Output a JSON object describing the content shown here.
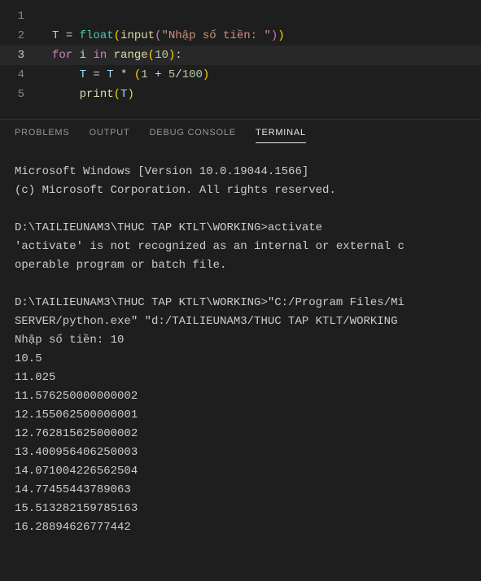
{
  "editor": {
    "lines": [
      {
        "num": "1",
        "tokens": []
      },
      {
        "num": "2",
        "tokens": [
          {
            "t": "T",
            "c": "tok-var"
          },
          {
            "t": " ",
            "c": "tok-op"
          },
          {
            "t": "=",
            "c": "tok-op"
          },
          {
            "t": " ",
            "c": "tok-op"
          },
          {
            "t": "float",
            "c": "tok-builtin"
          },
          {
            "t": "(",
            "c": "tok-paren-y"
          },
          {
            "t": "input",
            "c": "tok-func"
          },
          {
            "t": "(",
            "c": "tok-paren-p"
          },
          {
            "t": "\"Nhập số tiền: \"",
            "c": "tok-str"
          },
          {
            "t": ")",
            "c": "tok-paren-p"
          },
          {
            "t": ")",
            "c": "tok-paren-y"
          }
        ]
      },
      {
        "num": "3",
        "active": true,
        "tokens": [
          {
            "t": "for",
            "c": "tok-keyword"
          },
          {
            "t": " ",
            "c": "tok-op"
          },
          {
            "t": "i",
            "c": "tok-var"
          },
          {
            "t": " ",
            "c": "tok-op"
          },
          {
            "t": "in",
            "c": "tok-keyword"
          },
          {
            "t": " ",
            "c": "tok-op"
          },
          {
            "t": "range",
            "c": "tok-func"
          },
          {
            "t": "(",
            "c": "tok-paren-y"
          },
          {
            "t": "10",
            "c": "tok-num"
          },
          {
            "t": ")",
            "c": "tok-paren-y"
          },
          {
            "t": ":",
            "c": "tok-op"
          }
        ]
      },
      {
        "num": "4",
        "tokens": [
          {
            "t": "    ",
            "c": "tok-op"
          },
          {
            "t": "T",
            "c": "tok-var"
          },
          {
            "t": " ",
            "c": "tok-op"
          },
          {
            "t": "=",
            "c": "tok-op"
          },
          {
            "t": " ",
            "c": "tok-op"
          },
          {
            "t": "T",
            "c": "tok-var"
          },
          {
            "t": " ",
            "c": "tok-op"
          },
          {
            "t": "*",
            "c": "tok-op"
          },
          {
            "t": " ",
            "c": "tok-op"
          },
          {
            "t": "(",
            "c": "tok-paren-y"
          },
          {
            "t": "1",
            "c": "tok-num"
          },
          {
            "t": " ",
            "c": "tok-op"
          },
          {
            "t": "+",
            "c": "tok-op"
          },
          {
            "t": " ",
            "c": "tok-op"
          },
          {
            "t": "5",
            "c": "tok-num"
          },
          {
            "t": "/",
            "c": "tok-op"
          },
          {
            "t": "100",
            "c": "tok-num"
          },
          {
            "t": ")",
            "c": "tok-paren-y"
          }
        ]
      },
      {
        "num": "5",
        "tokens": [
          {
            "t": "    ",
            "c": "tok-op"
          },
          {
            "t": "print",
            "c": "tok-func"
          },
          {
            "t": "(",
            "c": "tok-paren-y"
          },
          {
            "t": "T",
            "c": "tok-var"
          },
          {
            "t": ")",
            "c": "tok-paren-y"
          }
        ]
      }
    ]
  },
  "panel": {
    "tabs": [
      {
        "label": "PROBLEMS",
        "active": false
      },
      {
        "label": "OUTPUT",
        "active": false
      },
      {
        "label": "DEBUG CONSOLE",
        "active": false
      },
      {
        "label": "TERMINAL",
        "active": true
      }
    ]
  },
  "terminal": {
    "lines": [
      "Microsoft Windows [Version 10.0.19044.1566]",
      "(c) Microsoft Corporation. All rights reserved.",
      "",
      "D:\\TAILIEUNAM3\\THUC TAP KTLT\\WORKING>activate",
      "'activate' is not recognized as an internal or external c",
      "operable program or batch file.",
      "",
      "D:\\TAILIEUNAM3\\THUC TAP KTLT\\WORKING>\"C:/Program Files/Mi",
      "SERVER/python.exe\" \"d:/TAILIEUNAM3/THUC TAP KTLT/WORKING ",
      "Nhập số tiền: 10",
      "10.5",
      "11.025",
      "11.576250000000002",
      "12.155062500000001",
      "12.762815625000002",
      "13.400956406250003",
      "14.071004226562504",
      "14.77455443789063",
      "15.513282159785163",
      "16.28894626777442"
    ]
  }
}
